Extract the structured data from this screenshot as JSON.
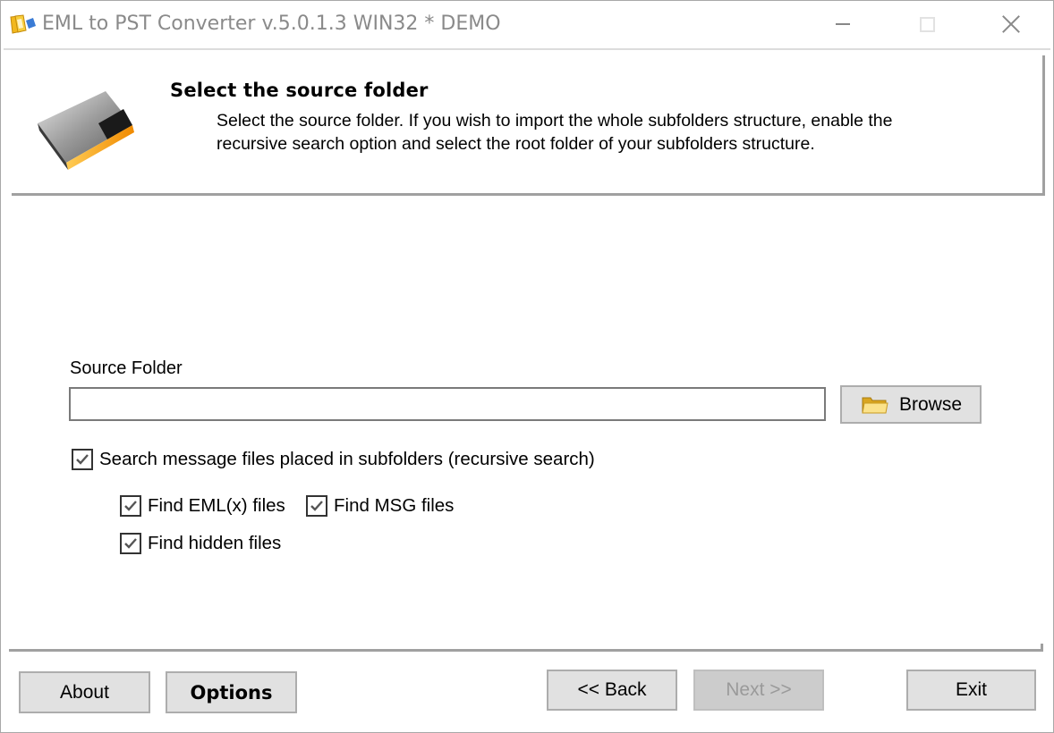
{
  "window": {
    "title": "EML to PST Converter v.5.0.1.3 WIN32 * DEMO",
    "icon": "app-logo-icon",
    "controls": {
      "minimize": "minimize-icon",
      "maximize": "maximize-icon",
      "close": "close-icon"
    }
  },
  "header": {
    "title": "Select the source folder",
    "description_line1": "Select the source folder. If you wish to import the whole subfolders structure, enable the",
    "description_line2": "recursive search option and select the root folder of your subfolders structure.",
    "icon": "folder-card-icon"
  },
  "form": {
    "source_label": "Source Folder",
    "source_value": "",
    "source_placeholder": "",
    "browse_label": "Browse",
    "browse_icon": "folder-icon",
    "recursive": {
      "label": "Search message files placed in subfolders (recursive search)",
      "checked": true
    },
    "find_eml": {
      "label": "Find EML(x) files",
      "checked": true
    },
    "find_msg": {
      "label": "Find MSG files",
      "checked": true
    },
    "find_hidden": {
      "label": "Find hidden files",
      "checked": true
    }
  },
  "footer": {
    "about_label": "About",
    "options_label": "Options",
    "back_label": "<< Back",
    "next_label": "Next >>",
    "next_enabled": false,
    "exit_label": "Exit"
  }
}
